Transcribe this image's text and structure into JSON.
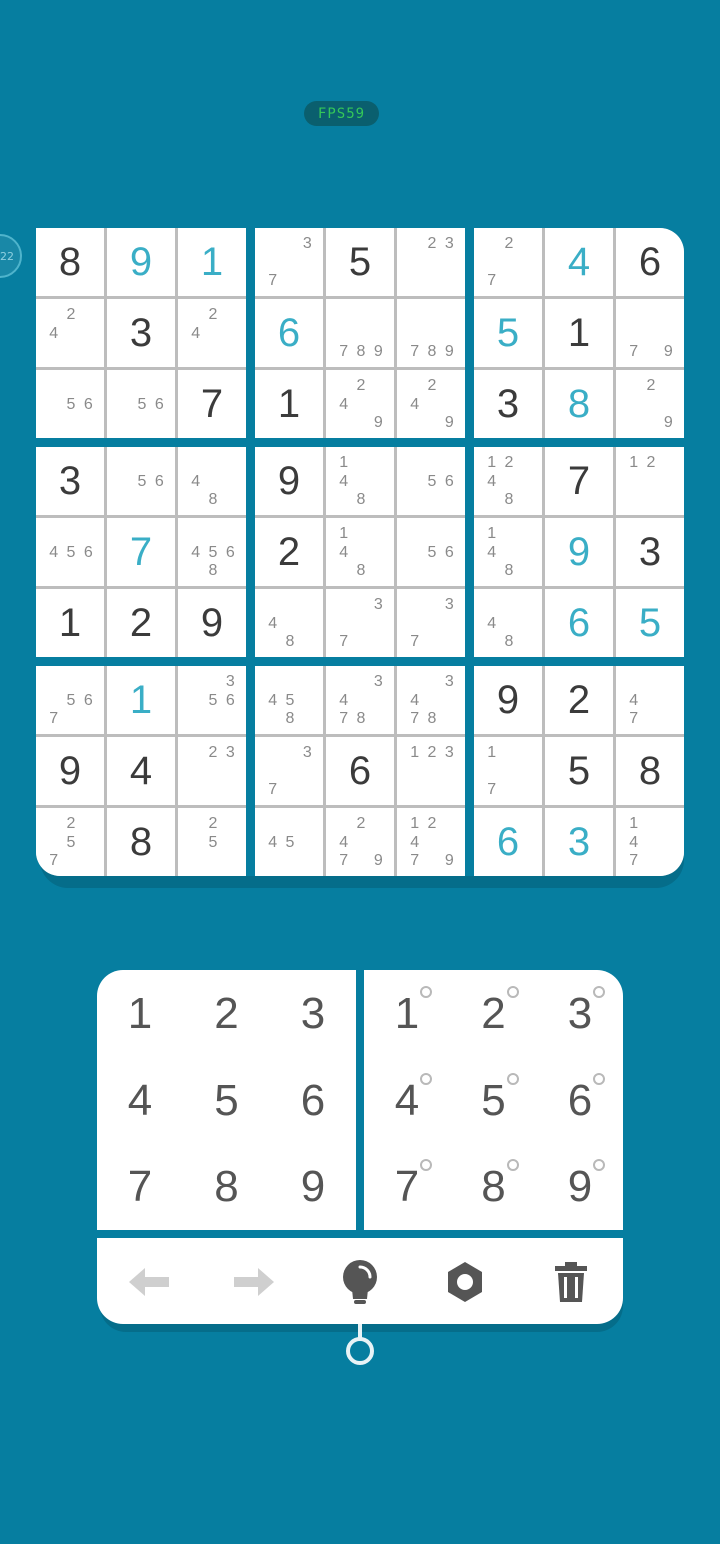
{
  "fps_label": "FPS59",
  "zoom_badge": "22",
  "colors": {
    "background": "#067ea0",
    "given_digit": "#3b3b3b",
    "user_digit": "#3aaec6",
    "note": "#8a8a8a"
  },
  "board": [
    [
      {
        "v": "8",
        "t": "given"
      },
      {
        "v": "9",
        "t": "user"
      },
      {
        "v": "1",
        "t": "user"
      },
      {
        "n": "37"
      },
      {
        "v": "5",
        "t": "given"
      },
      {
        "n": "23"
      },
      {
        "n": "27"
      },
      {
        "v": "4",
        "t": "user"
      },
      {
        "v": "6",
        "t": "given"
      }
    ],
    [
      {
        "n": "24"
      },
      {
        "v": "3",
        "t": "given"
      },
      {
        "n": "24"
      },
      {
        "v": "6",
        "t": "user"
      },
      {
        "n": "789"
      },
      {
        "n": "789"
      },
      {
        "v": "5",
        "t": "user"
      },
      {
        "v": "1",
        "t": "given"
      },
      {
        "n": "79"
      }
    ],
    [
      {
        "n": "56"
      },
      {
        "n": "56"
      },
      {
        "v": "7",
        "t": "given"
      },
      {
        "v": "1",
        "t": "given"
      },
      {
        "n": "249"
      },
      {
        "n": "249"
      },
      {
        "v": "3",
        "t": "given"
      },
      {
        "v": "8",
        "t": "user"
      },
      {
        "n": "29"
      }
    ],
    [
      {
        "v": "3",
        "t": "given"
      },
      {
        "n": "56"
      },
      {
        "n": "48"
      },
      {
        "v": "9",
        "t": "given"
      },
      {
        "n": "148"
      },
      {
        "n": "56"
      },
      {
        "n": "1248"
      },
      {
        "v": "7",
        "t": "given"
      },
      {
        "n": "12"
      }
    ],
    [
      {
        "n": "456"
      },
      {
        "v": "7",
        "t": "user"
      },
      {
        "n": "4568"
      },
      {
        "v": "2",
        "t": "given"
      },
      {
        "n": "148"
      },
      {
        "n": "56"
      },
      {
        "n": "148"
      },
      {
        "v": "9",
        "t": "user"
      },
      {
        "v": "3",
        "t": "given"
      }
    ],
    [
      {
        "v": "1",
        "t": "given"
      },
      {
        "v": "2",
        "t": "given"
      },
      {
        "v": "9",
        "t": "given"
      },
      {
        "n": "48"
      },
      {
        "n": "37"
      },
      {
        "n": "37"
      },
      {
        "n": "48"
      },
      {
        "v": "6",
        "t": "user"
      },
      {
        "v": "5",
        "t": "user"
      }
    ],
    [
      {
        "n": "567"
      },
      {
        "v": "1",
        "t": "user"
      },
      {
        "n": "356"
      },
      {
        "n": "458"
      },
      {
        "n": "3478"
      },
      {
        "n": "3478"
      },
      {
        "v": "9",
        "t": "given"
      },
      {
        "v": "2",
        "t": "given"
      },
      {
        "n": "47"
      }
    ],
    [
      {
        "v": "9",
        "t": "given"
      },
      {
        "v": "4",
        "t": "given"
      },
      {
        "n": "23"
      },
      {
        "n": "37"
      },
      {
        "v": "6",
        "t": "given"
      },
      {
        "n": "123"
      },
      {
        "n": "17"
      },
      {
        "v": "5",
        "t": "given"
      },
      {
        "v": "8",
        "t": "given"
      }
    ],
    [
      {
        "n": "257"
      },
      {
        "v": "8",
        "t": "given"
      },
      {
        "n": "25"
      },
      {
        "n": "45"
      },
      {
        "n": "2479"
      },
      {
        "n": "12479"
      },
      {
        "v": "6",
        "t": "user"
      },
      {
        "v": "3",
        "t": "user"
      },
      {
        "n": "147"
      }
    ]
  ],
  "pad": {
    "normal": [
      "1",
      "2",
      "3",
      "4",
      "5",
      "6",
      "7",
      "8",
      "9"
    ],
    "notes": [
      "1",
      "2",
      "3",
      "4",
      "5",
      "6",
      "7",
      "8",
      "9"
    ]
  },
  "toolbar": [
    {
      "name": "undo",
      "icon": "arrow-left-icon",
      "enabled": false
    },
    {
      "name": "redo",
      "icon": "arrow-right-icon",
      "enabled": false
    },
    {
      "name": "hint",
      "icon": "lightbulb-icon",
      "enabled": true
    },
    {
      "name": "settings",
      "icon": "gear-icon",
      "enabled": true
    },
    {
      "name": "delete",
      "icon": "trash-icon",
      "enabled": true
    }
  ]
}
